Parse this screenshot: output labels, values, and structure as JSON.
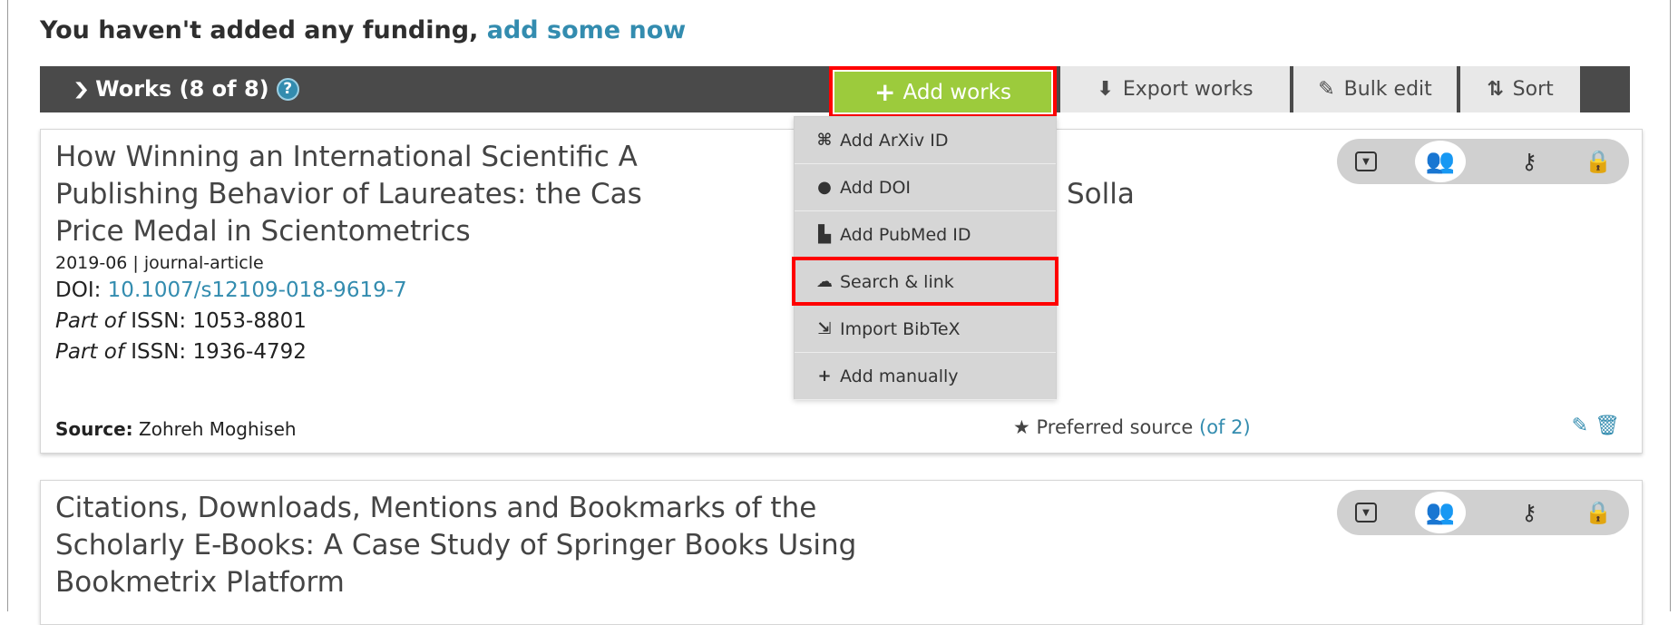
{
  "funding": {
    "text": "You haven't added any funding,",
    "link": "add some now"
  },
  "works_bar": {
    "title": "Works (8 of 8)",
    "help": "?",
    "add_works": "Add works",
    "export": "Export works",
    "bulk_edit": "Bulk edit",
    "sort": "Sort"
  },
  "add_works_menu": {
    "items": [
      {
        "label": "Add ArXiv ID",
        "icon": "arxiv-icon"
      },
      {
        "label": "Add DOI",
        "icon": "doi-icon"
      },
      {
        "label": "Add PubMed ID",
        "icon": "pubmed-icon"
      },
      {
        "label": "Search & link",
        "icon": "cloud-link-icon",
        "highlighted": true
      },
      {
        "label": "Import BibTeX",
        "icon": "import-icon"
      },
      {
        "label": "Add manually",
        "icon": "plus-icon"
      }
    ]
  },
  "works": [
    {
      "title_lines": [
        "How Winning an International Scientific A",
        "Publishing Behavior of Laureates: the Cas",
        "Price Medal in Scientometrics"
      ],
      "title_tail": "Solla",
      "date_type": "2019-06 | journal-article",
      "doi_label": "DOI:",
      "doi": "10.1007/s12109-018-9619-7",
      "part_of_label": "Part of",
      "issn1": "ISSN: 1053-8801",
      "issn2": "ISSN: 1936-4792",
      "source_label": "Source:",
      "source": "Zohreh Moghiseh",
      "preferred": "Preferred source",
      "preferred_count": "(of 2)"
    },
    {
      "title_lines": [
        "Citations, Downloads, Mentions and Bookmarks of the",
        "Scholarly E-Books: A Case Study of Springer Books Using",
        "Bookmetrix Platform"
      ]
    }
  ],
  "colors": {
    "bar": "#4a4a4a",
    "add_works_green": "#9ccb3c",
    "link_blue": "#338caf",
    "highlight_red": "#ff0000",
    "people_green": "#2e8b2e"
  }
}
